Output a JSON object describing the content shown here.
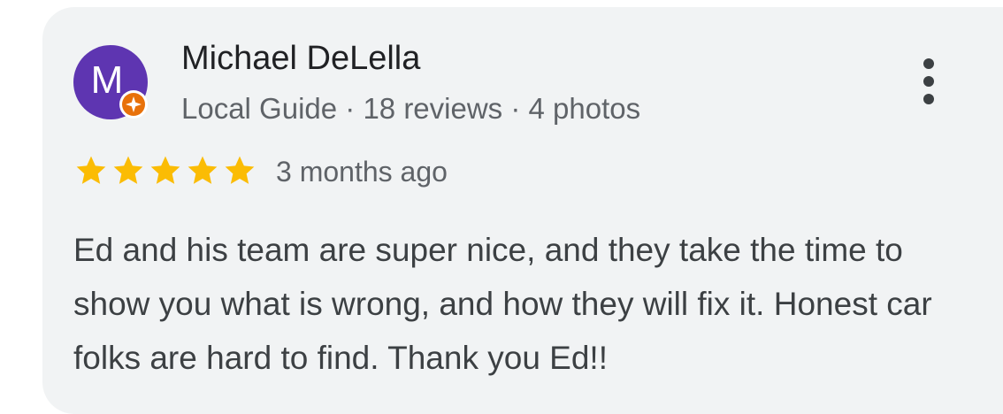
{
  "review": {
    "author": {
      "name": "Michael DeLella",
      "avatar_initial": "M",
      "avatar_color": "#5e35b1",
      "badge_icon": "local-guide-badge-icon",
      "badge_color": "#e8710a",
      "meta": "Local Guide · 18 reviews · 4 photos"
    },
    "rating": {
      "value": 5,
      "max": 5,
      "star_color": "#fbbc04",
      "icon": "star-icon"
    },
    "time_ago": "3 months ago",
    "text": "Ed and his team are super nice, and they take the time to show you what is wrong, and how they will fix it. Honest car folks are hard to find. Thank you Ed!!",
    "menu_icon": "more-vert-icon"
  }
}
